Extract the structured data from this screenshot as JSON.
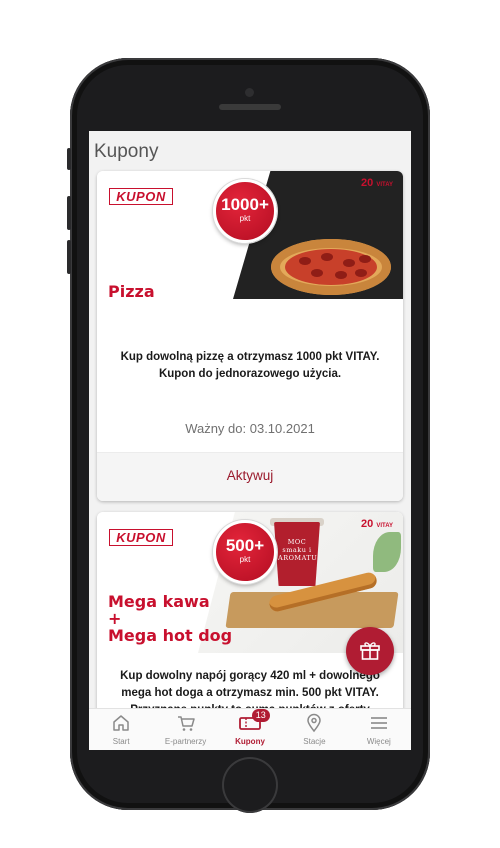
{
  "screen": {
    "title": "Kupony"
  },
  "coupons": [
    {
      "tag": "KUPON",
      "points_value": "1000+",
      "points_unit": "pkt",
      "anniversary_mark": "20",
      "anniversary_sub": "VITAY",
      "offer_title": "Pizza",
      "description": "Kup dowolną pizzę a otrzymasz 1000 pkt VITAY. Kupon do jednorazowego użycia.",
      "valid_until": "Ważny do: 03.10.2021",
      "action_label": "Aktywuj"
    },
    {
      "tag": "KUPON",
      "points_value": "500+",
      "points_unit": "pkt",
      "anniversary_mark": "20",
      "anniversary_sub": "VITAY",
      "cup_text": "MOC smaku i AROMATU",
      "offer_title": "Mega kawa\n+\nMega hot dog",
      "description": "Kup dowolny napój gorący 420 ml + dowolnego mega hot doga a otrzymasz min. 500 pkt VITAY. Przyznane punkty to suma punktów z oferty podstawowej i dodatkowej oraz"
    }
  ],
  "fab": {
    "icon": "gift-icon"
  },
  "tabbar": {
    "tabs": [
      {
        "label": "Start",
        "icon": "home-icon"
      },
      {
        "label": "E-partnerzy",
        "icon": "cart-icon"
      },
      {
        "label": "Kupony",
        "icon": "coupon-icon",
        "badge": "13",
        "active": true
      },
      {
        "label": "Stacje",
        "icon": "location-pin-icon"
      },
      {
        "label": "Więcej",
        "icon": "menu-icon"
      }
    ]
  },
  "colors": {
    "brand": "#c8102e",
    "accent_dark": "#b01c33",
    "screen_bg": "#f2f2f2"
  }
}
